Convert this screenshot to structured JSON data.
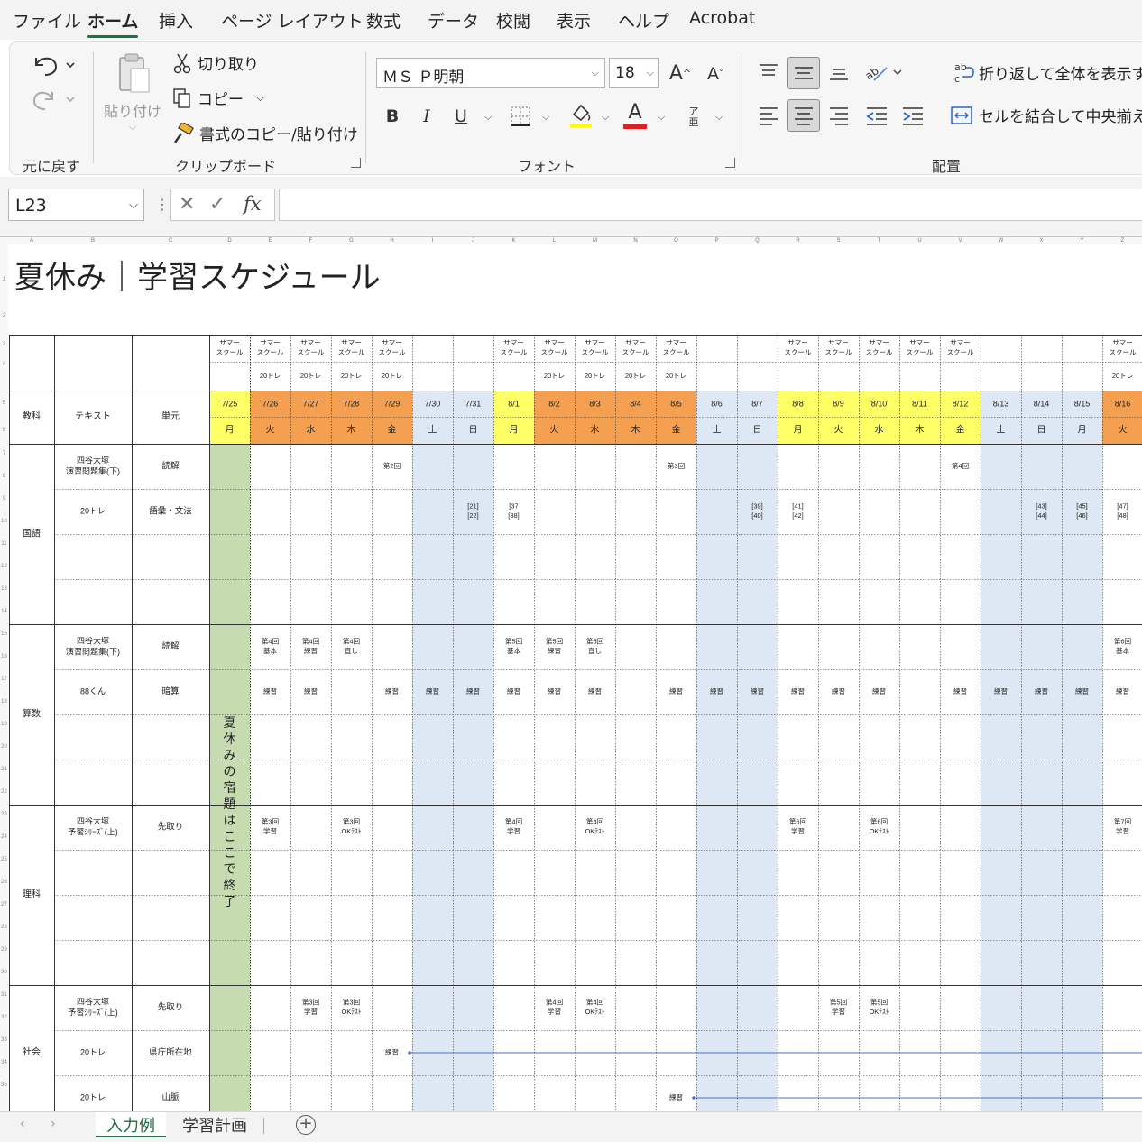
{
  "menu": {
    "items": [
      "ファイル",
      "ホーム",
      "挿入",
      "ページ レイアウト",
      "数式",
      "データ",
      "校閲",
      "表示",
      "ヘルプ",
      "Acrobat"
    ],
    "active": "ホーム"
  },
  "ribbon": {
    "undo_group_label": "元に戻す",
    "clipboard": {
      "paste": "貼り付け",
      "cut": "切り取り",
      "copy": "コピー",
      "format_painter": "書式のコピー/貼り付け",
      "label": "クリップボード"
    },
    "font": {
      "name": "ＭＳ Ｐ明朝",
      "size": "18",
      "label": "フォント",
      "bold": "B",
      "italic": "I",
      "underline": "U",
      "grow": "A",
      "shrink": "A",
      "color_letter": "A",
      "phonetic": "ア亜"
    },
    "alignment": {
      "wrap": "折り返して全体を表示する",
      "merge": "セルを結合して中央揃え",
      "label": "配置"
    },
    "colors": {
      "accent": "#1e7145",
      "highlight": "#ffff00",
      "font_color": "#e02020"
    }
  },
  "formula_bar": {
    "name_box": "L23",
    "fx": "fx",
    "value": ""
  },
  "sheet": {
    "title": "夏休み｜学習スケジュール",
    "column_letters": [
      "A",
      "B",
      "C",
      "D",
      "E",
      "F",
      "G",
      "H",
      "I",
      "J",
      "K",
      "L",
      "M",
      "N",
      "O",
      "P",
      "Q",
      "R",
      "S",
      "T",
      "U",
      "V",
      "W",
      "X",
      "Y",
      "Z"
    ],
    "row_numbers": [
      "1",
      "2",
      "3",
      "4",
      "5",
      "6",
      "7",
      "8",
      "9",
      "10",
      "11",
      "12",
      "13",
      "14",
      "15",
      "16",
      "17",
      "18",
      "19",
      "20",
      "21",
      "22",
      "23",
      "24",
      "25",
      "26",
      "27",
      "28",
      "29",
      "30",
      "31",
      "32",
      "33",
      "34",
      "35"
    ],
    "header": {
      "subject": "教科",
      "text": "テキスト",
      "unit": "単元"
    },
    "days": [
      {
        "sm": "サマー\nスクール",
        "tr": "",
        "date": "7/25",
        "dow": "月",
        "color": "yellow"
      },
      {
        "sm": "サマー\nスクール",
        "tr": "20トレ",
        "date": "7/26",
        "dow": "火",
        "color": "orange"
      },
      {
        "sm": "サマー\nスクール",
        "tr": "20トレ",
        "date": "7/27",
        "dow": "水",
        "color": "orange"
      },
      {
        "sm": "サマー\nスクール",
        "tr": "20トレ",
        "date": "7/28",
        "dow": "木",
        "color": "orange"
      },
      {
        "sm": "サマー\nスクール",
        "tr": "20トレ",
        "date": "7/29",
        "dow": "金",
        "color": "orange"
      },
      {
        "sm": "",
        "tr": "",
        "date": "7/30",
        "dow": "土",
        "color": "blue"
      },
      {
        "sm": "",
        "tr": "",
        "date": "7/31",
        "dow": "日",
        "color": "blue"
      },
      {
        "sm": "サマー\nスクール",
        "tr": "",
        "date": "8/1",
        "dow": "月",
        "color": "yellow"
      },
      {
        "sm": "サマー\nスクール",
        "tr": "20トレ",
        "date": "8/2",
        "dow": "火",
        "color": "orange"
      },
      {
        "sm": "サマー\nスクール",
        "tr": "20トレ",
        "date": "8/3",
        "dow": "水",
        "color": "orange"
      },
      {
        "sm": "サマー\nスクール",
        "tr": "20トレ",
        "date": "8/4",
        "dow": "木",
        "color": "orange"
      },
      {
        "sm": "サマー\nスクール",
        "tr": "20トレ",
        "date": "8/5",
        "dow": "金",
        "color": "orange"
      },
      {
        "sm": "",
        "tr": "",
        "date": "8/6",
        "dow": "土",
        "color": "blue"
      },
      {
        "sm": "",
        "tr": "",
        "date": "8/7",
        "dow": "日",
        "color": "blue"
      },
      {
        "sm": "サマー\nスクール",
        "tr": "",
        "date": "8/8",
        "dow": "月",
        "color": "yellow"
      },
      {
        "sm": "サマー\nスクール",
        "tr": "",
        "date": "8/9",
        "dow": "火",
        "color": "yellow"
      },
      {
        "sm": "サマー\nスクール",
        "tr": "",
        "date": "8/10",
        "dow": "水",
        "color": "yellow"
      },
      {
        "sm": "サマー\nスクール",
        "tr": "",
        "date": "8/11",
        "dow": "木",
        "color": "yellow"
      },
      {
        "sm": "サマー\nスクール",
        "tr": "",
        "date": "8/12",
        "dow": "金",
        "color": "yellow"
      },
      {
        "sm": "",
        "tr": "",
        "date": "8/13",
        "dow": "土",
        "color": "blue"
      },
      {
        "sm": "",
        "tr": "",
        "date": "8/14",
        "dow": "日",
        "color": "blue"
      },
      {
        "sm": "",
        "tr": "",
        "date": "8/15",
        "dow": "月",
        "color": "blue"
      },
      {
        "sm": "サマー\nスクール",
        "tr": "20トレ",
        "date": "8/16",
        "dow": "火",
        "color": "orange"
      }
    ],
    "vertical_note": "夏休みの宿題はここで終了",
    "subjects": [
      {
        "name": "国語",
        "rows": [
          {
            "text": "四谷大塚\n演習問題集(下)",
            "unit": "読解",
            "cells": {
              "4": "第2回",
              "11": "第3回",
              "18": "第4回"
            }
          },
          {
            "text": "20トレ",
            "unit": "語彙・文法",
            "cells": {
              "6": "[21]\n[22]",
              "7": "[37\n[38]",
              "13": "[39]\n[40]",
              "14": "[41]\n[42]",
              "20": "[43]\n[44]",
              "21": "[45]\n[46]",
              "22": "[47]\n[48]"
            }
          },
          {
            "text": "",
            "unit": "",
            "cells": {}
          },
          {
            "text": "",
            "unit": "",
            "cells": {}
          }
        ]
      },
      {
        "name": "算数",
        "rows": [
          {
            "text": "四谷大塚\n演習問題集(下)",
            "unit": "読解",
            "cells": {
              "1": "第4回\n基本",
              "2": "第4回\n練習",
              "3": "第4回\n直し",
              "7": "第5回\n基本",
              "8": "第5回\n練習",
              "9": "第5回\n直し",
              "22": "第6回\n基本"
            }
          },
          {
            "text": "88くん",
            "unit": "暗算",
            "cells": {
              "1": "練習",
              "2": "練習",
              "4": "練習",
              "5": "練習",
              "6": "練習",
              "7": "練習",
              "8": "練習",
              "9": "練習",
              "11": "練習",
              "12": "練習",
              "13": "練習",
              "14": "練習",
              "15": "練習",
              "16": "練習",
              "18": "練習",
              "19": "練習",
              "20": "練習",
              "21": "練習",
              "22": "練習"
            }
          },
          {
            "text": "",
            "unit": "",
            "cells": {}
          },
          {
            "text": "",
            "unit": "",
            "cells": {}
          }
        ]
      },
      {
        "name": "理科",
        "rows": [
          {
            "text": "四谷大塚\n予習ｼﾘｰｽﾞ(上)",
            "unit": "先取り",
            "cells": {
              "1": "第3回\n学習",
              "3": "第3回\nOKﾃｽﾄ",
              "7": "第4回\n学習",
              "9": "第4回\nOKﾃｽﾄ",
              "14": "第6回\n学習",
              "16": "第6回\nOKﾃｽﾄ",
              "22": "第7回\n学習"
            }
          },
          {
            "text": "",
            "unit": "",
            "cells": {}
          },
          {
            "text": "",
            "unit": "",
            "cells": {}
          },
          {
            "text": "",
            "unit": "",
            "cells": {}
          }
        ]
      },
      {
        "name": "社会",
        "rows": [
          {
            "text": "四谷大塚\n予習ｼﾘｰｽﾞ(上)",
            "unit": "先取り",
            "cells": {
              "2": "第3回\n学習",
              "3": "第3回\nOKﾃｽﾄ",
              "8": "第4回\n学習",
              "9": "第4回\nOKﾃｽﾄ",
              "15": "第5回\n学習",
              "16": "第5回\nOKﾃｽﾄ"
            }
          },
          {
            "text": "20トレ",
            "unit": "県庁所在地",
            "cells": {
              "4": "練習"
            },
            "arrow_from": 4
          },
          {
            "text": "20トレ",
            "unit": "山脈",
            "cells": {
              "11": "練習"
            },
            "arrow_from": 11
          }
        ]
      }
    ]
  },
  "tabs": {
    "items": [
      "入力例",
      "学習計画"
    ],
    "active": "入力例"
  }
}
